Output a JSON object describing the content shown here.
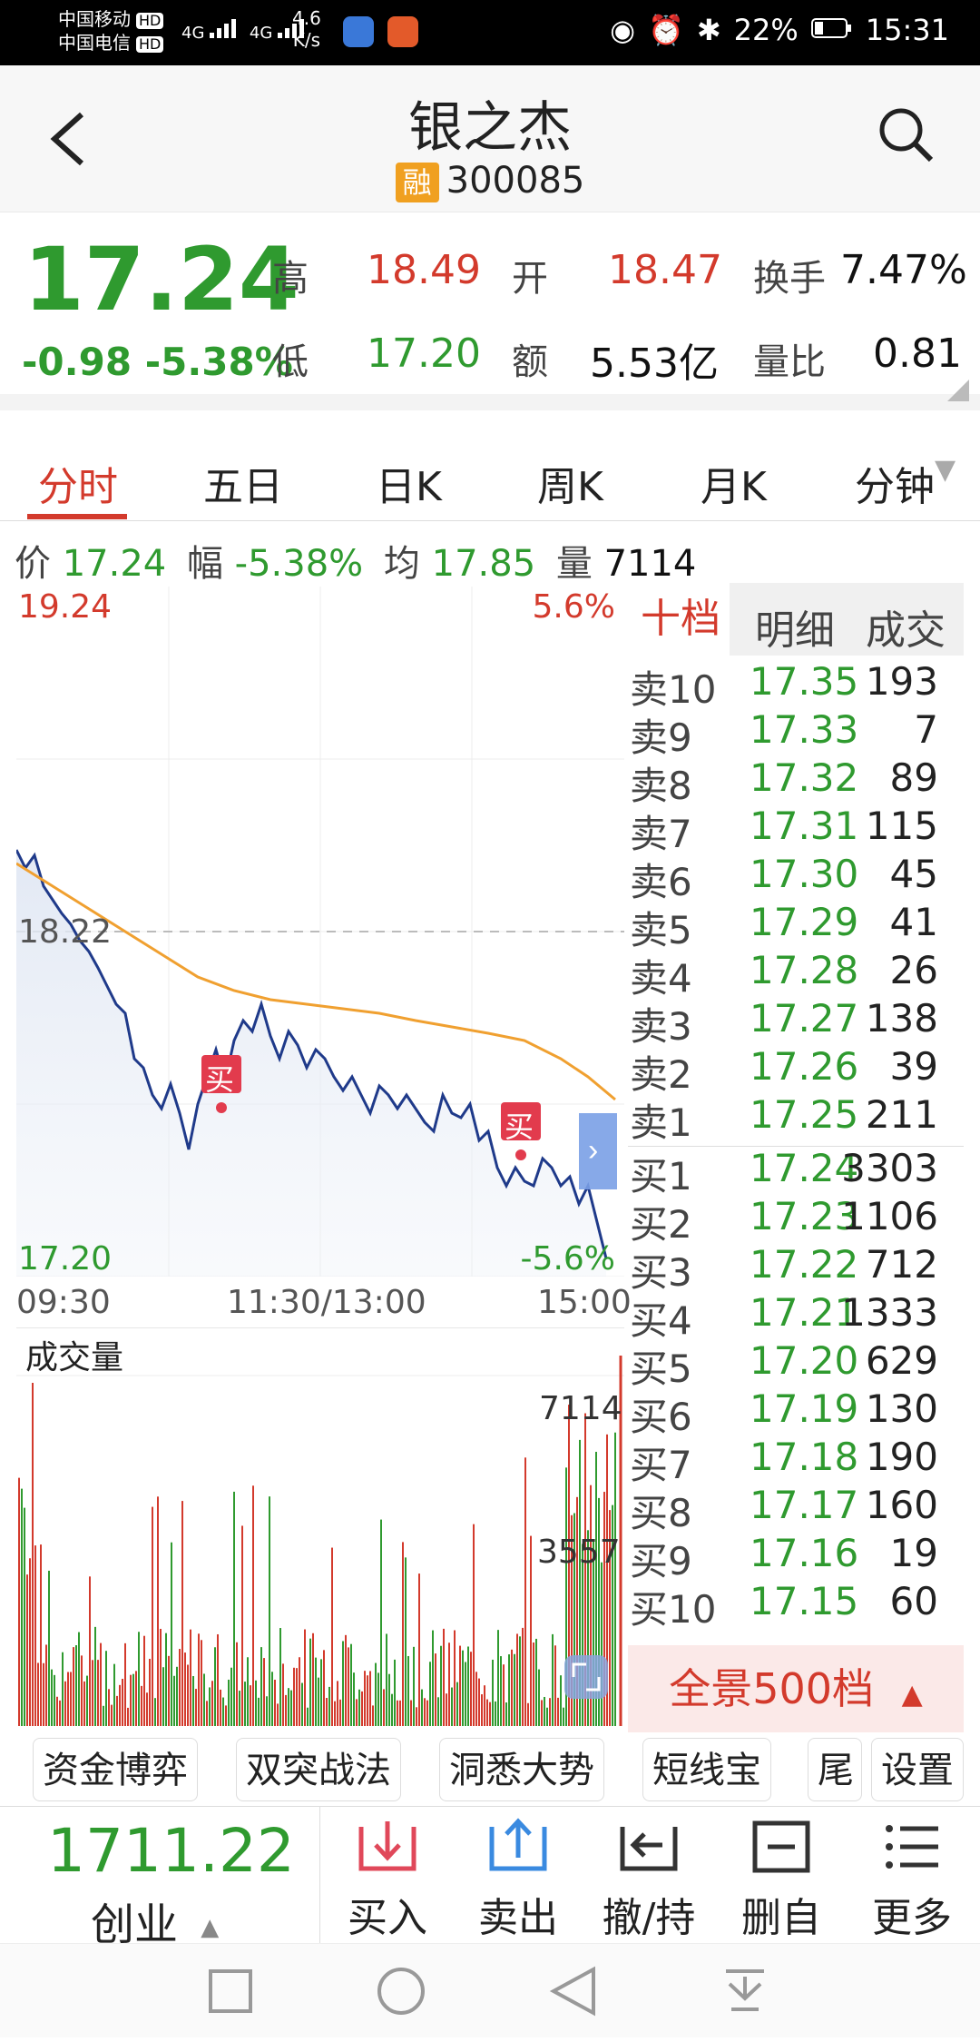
{
  "status_bar": {
    "carrier1": "中国移动",
    "carrier2": "中国电信",
    "hd": "HD",
    "net1": "4G",
    "net2": "4G",
    "speed_value": "4.6",
    "speed_unit": "K/s",
    "battery": "22%",
    "time": "15:31"
  },
  "header": {
    "title": "银之杰",
    "rong_badge": "融",
    "code": "300085"
  },
  "quote": {
    "price": "17.24",
    "change": "-0.98",
    "change_pct": "-5.38%",
    "high_label": "高",
    "high": "18.49",
    "open_label": "开",
    "open": "18.47",
    "turnover_label": "换手",
    "turnover": "7.47%",
    "low_label": "低",
    "low": "17.20",
    "amount_label": "额",
    "amount": "5.53亿",
    "volratio_label": "量比",
    "volratio": "0.81"
  },
  "tabs": [
    "分时",
    "五日",
    "日K",
    "周K",
    "月K",
    "分钟"
  ],
  "info": {
    "price_label": "价",
    "price": "17.24",
    "range_label": "幅",
    "range": "-5.38%",
    "avg_label": "均",
    "avg": "17.85",
    "vol_label": "量",
    "vol": "7114"
  },
  "chart_labels": {
    "top_price": "19.24",
    "top_pct": "5.6%",
    "mid_price": "18.22",
    "bottom_price": "17.20",
    "bottom_pct": "-5.6%",
    "time_start": "09:30",
    "time_mid": "11:30/13:00",
    "time_end": "15:00",
    "buy_marker": "买",
    "volume_title": "成交量",
    "vol_max": "7114",
    "vol_mid": "3557"
  },
  "colors": {
    "red": "#d33a2c",
    "green": "#2f9a2f",
    "price_line": "#1f3a8a",
    "avg_line": "#f0a030"
  },
  "orderbook": {
    "tabs": [
      "十档",
      "明细",
      "成交"
    ],
    "asks": [
      {
        "label": "卖10",
        "price": "17.35",
        "vol": "193"
      },
      {
        "label": "卖9",
        "price": "17.33",
        "vol": "7"
      },
      {
        "label": "卖8",
        "price": "17.32",
        "vol": "89"
      },
      {
        "label": "卖7",
        "price": "17.31",
        "vol": "115"
      },
      {
        "label": "卖6",
        "price": "17.30",
        "vol": "45"
      },
      {
        "label": "卖5",
        "price": "17.29",
        "vol": "41"
      },
      {
        "label": "卖4",
        "price": "17.28",
        "vol": "26"
      },
      {
        "label": "卖3",
        "price": "17.27",
        "vol": "138"
      },
      {
        "label": "卖2",
        "price": "17.26",
        "vol": "39"
      },
      {
        "label": "卖1",
        "price": "17.25",
        "vol": "211"
      }
    ],
    "bids": [
      {
        "label": "买1",
        "price": "17.24",
        "vol": "3303"
      },
      {
        "label": "买2",
        "price": "17.23",
        "vol": "1106"
      },
      {
        "label": "买3",
        "price": "17.22",
        "vol": "712"
      },
      {
        "label": "买4",
        "price": "17.21",
        "vol": "1333"
      },
      {
        "label": "买5",
        "price": "17.20",
        "vol": "629"
      },
      {
        "label": "买6",
        "price": "17.19",
        "vol": "130"
      },
      {
        "label": "买7",
        "price": "17.18",
        "vol": "190"
      },
      {
        "label": "买8",
        "price": "17.17",
        "vol": "160"
      },
      {
        "label": "买9",
        "price": "17.16",
        "vol": "19"
      },
      {
        "label": "买10",
        "price": "17.15",
        "vol": "60"
      }
    ],
    "panorama": "全景500档"
  },
  "chips": [
    "资金博弈",
    "双突战法",
    "洞悉大势",
    "短线宝",
    "尾",
    "设置"
  ],
  "toolbar": {
    "index_value": "1711.22",
    "index_name": "创业",
    "buttons": [
      {
        "label": "买入",
        "icon": "buy-arrow-icon"
      },
      {
        "label": "卖出",
        "icon": "sell-arrow-icon"
      },
      {
        "label": "撤/持",
        "icon": "cancel-hold-icon"
      },
      {
        "label": "删自选",
        "icon": "remove-watchlist-icon"
      },
      {
        "label": "更多",
        "icon": "menu-icon"
      }
    ]
  }
}
